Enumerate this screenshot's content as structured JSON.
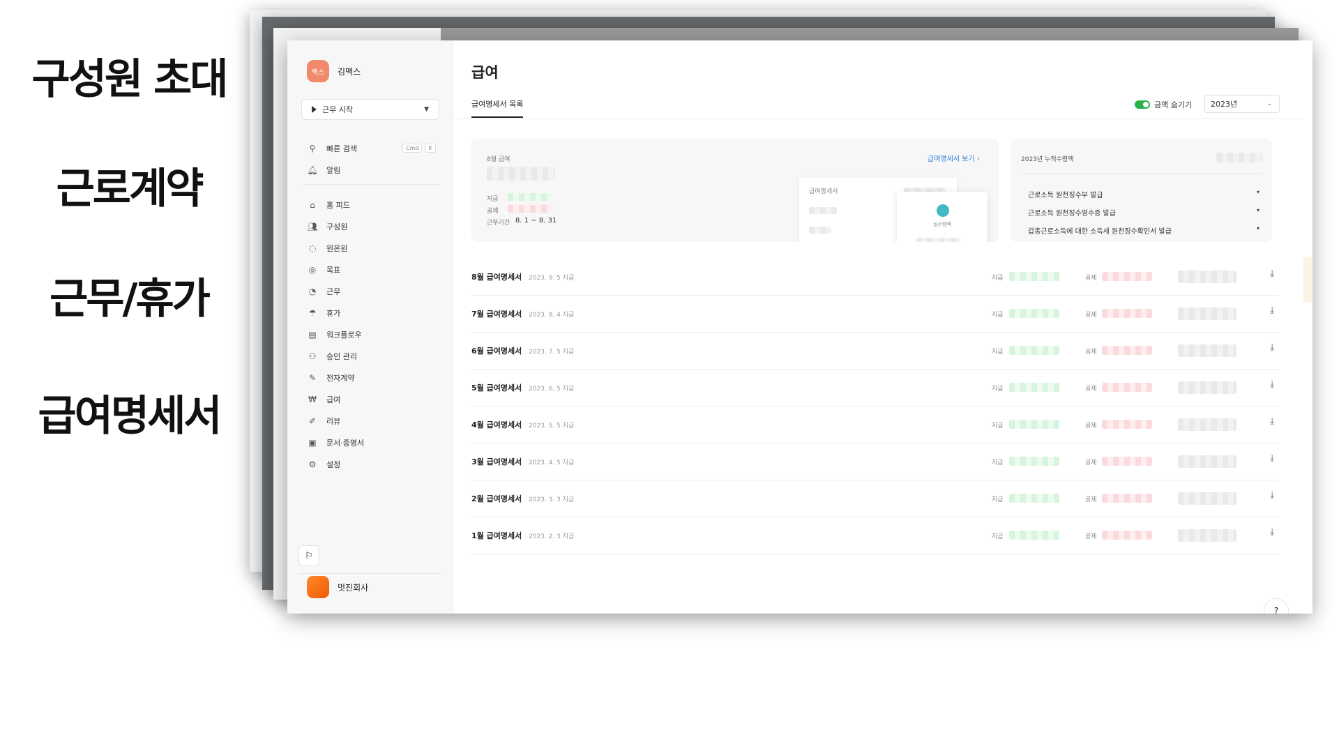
{
  "slide_labels": [
    "구성원 초대",
    "근로계약",
    "근무/휴가",
    "급여명세서"
  ],
  "sidebar": {
    "avatar_text": "맥스",
    "user_name": "김맥스",
    "start_button": "근무 시작",
    "quick_search": "빠른 검색",
    "shortcut": [
      "Cmd",
      "K"
    ],
    "notifications": "알림",
    "items": [
      {
        "label": "홈 피드",
        "icon": "home-icon"
      },
      {
        "label": "구성원",
        "icon": "people-icon"
      },
      {
        "label": "원온원",
        "icon": "chat-icon"
      },
      {
        "label": "목표",
        "icon": "target-icon"
      },
      {
        "label": "근무",
        "icon": "clock-icon"
      },
      {
        "label": "휴가",
        "icon": "umbrella-icon"
      },
      {
        "label": "워크플로우",
        "icon": "workflow-icon"
      },
      {
        "label": "승인 관리",
        "icon": "approval-icon"
      },
      {
        "label": "전자계약",
        "icon": "contract-icon"
      },
      {
        "label": "급여",
        "icon": "payroll-icon"
      },
      {
        "label": "리뷰",
        "icon": "pen-icon"
      },
      {
        "label": "문서·증명서",
        "icon": "document-icon"
      },
      {
        "label": "설정",
        "icon": "settings-icon"
      }
    ],
    "company_name": "멋진회사"
  },
  "main": {
    "title": "급여",
    "tab": "급여명세서 목록",
    "hide_amount_label": "금액 숨기기",
    "hide_amount_on": true,
    "year_select": "2023년",
    "summary": {
      "month_label": "8월 급여",
      "pay_label": "지급",
      "deduct_label": "공제",
      "period_label": "근무기간",
      "period_value": "8. 1 ~ 8. 31",
      "view_link": "급여명세서 보기",
      "mock_title": "급여명세서",
      "mock_pop_label": "실수령액"
    },
    "tax_card": {
      "title": "2023년 누적수령액",
      "rows": [
        "근로소득 원천징수부 발급",
        "근로소득 원천징수영수증 발급",
        "갑종근로소득에 대한 소득세 원천징수확인서 발급"
      ]
    },
    "statements": [
      {
        "title": "8월 급여명세서",
        "date": "2023. 9. 5 지급"
      },
      {
        "title": "7월 급여명세서",
        "date": "2023. 8. 4 지급"
      },
      {
        "title": "6월 급여명세서",
        "date": "2023. 7. 5 지급"
      },
      {
        "title": "5월 급여명세서",
        "date": "2023. 6. 5 지급"
      },
      {
        "title": "4월 급여명세서",
        "date": "2023. 5. 5 지급"
      },
      {
        "title": "3월 급여명세서",
        "date": "2023. 4. 5 지급"
      },
      {
        "title": "2월 급여명세서",
        "date": "2023. 3. 3 지급"
      },
      {
        "title": "1월 급여명세서",
        "date": "2023. 2. 3 지급"
      }
    ],
    "row_pay_label": "지급",
    "row_deduct_label": "공제"
  },
  "colors": {
    "toggle_on": "#27b24a",
    "link": "#2a7bd4",
    "avatar": "#f08a6a",
    "company_logo": "#f26a10"
  }
}
